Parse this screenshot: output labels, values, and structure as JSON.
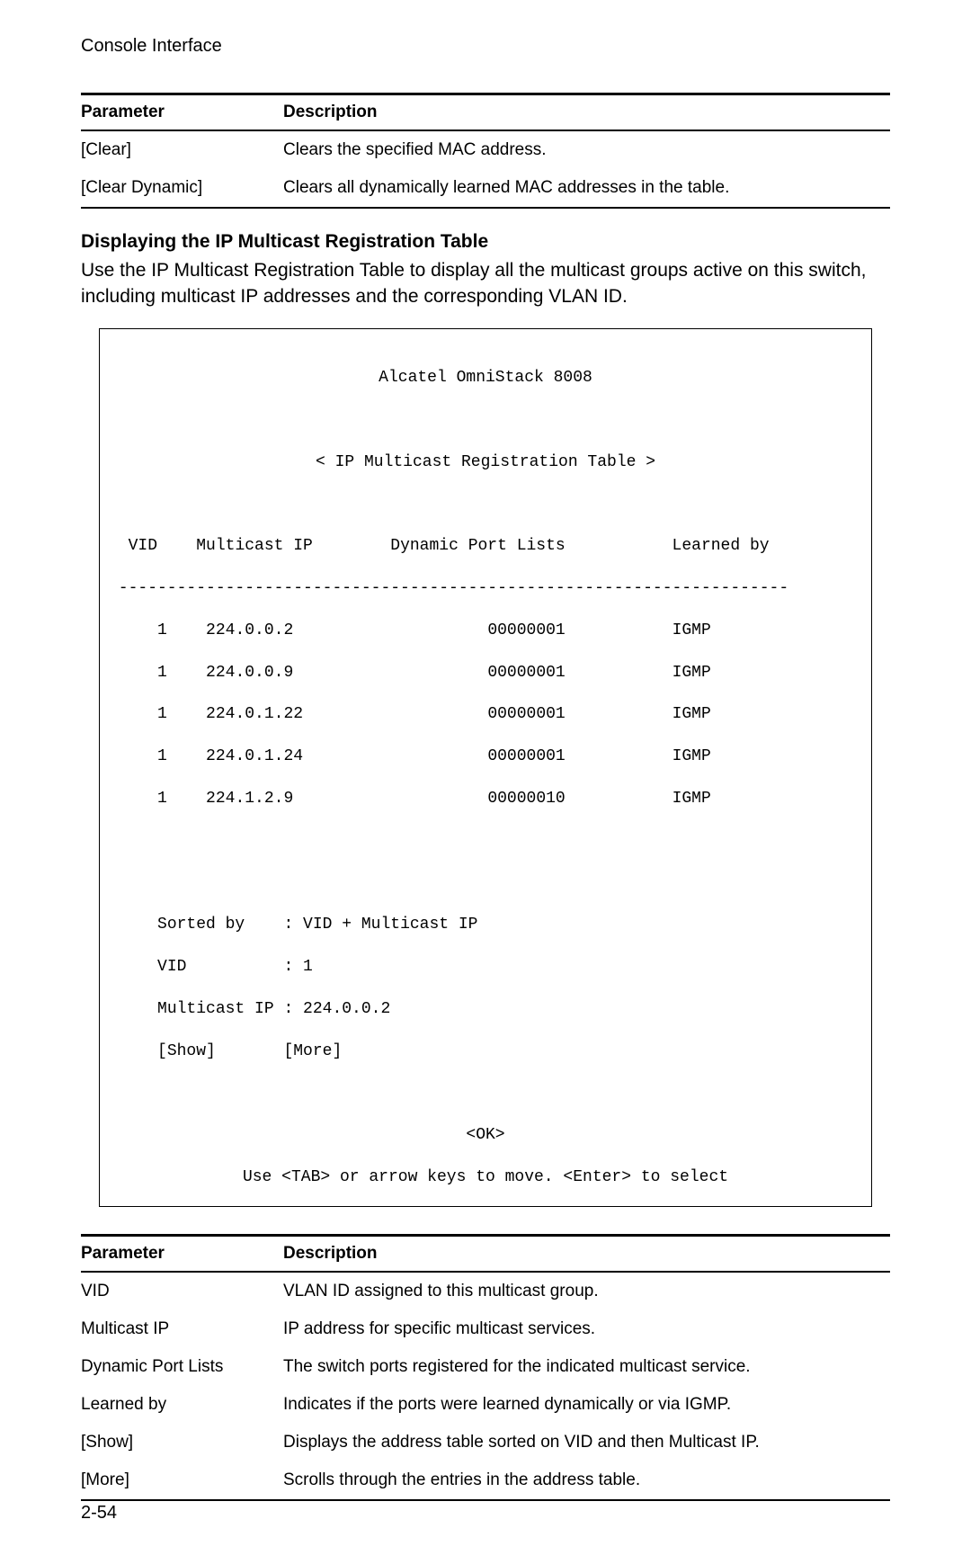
{
  "header": {
    "section_title": "Console Interface"
  },
  "table1": {
    "param_header": "Parameter",
    "desc_header": "Description",
    "rows": [
      {
        "param": "[Clear]",
        "desc": "Clears the specified MAC address."
      },
      {
        "param": "[Clear Dynamic]",
        "desc": "Clears all dynamically learned MAC addresses in the table."
      }
    ]
  },
  "subsection": {
    "heading": "Displaying the IP Multicast Registration Table",
    "body": "Use the IP Multicast Registration Table to display all the multicast groups active on this switch, including multicast IP addresses and the corresponding VLAN ID."
  },
  "console": {
    "device": "Alcatel OmniStack 8008",
    "screen_title": "< IP Multicast Registration Table >",
    "col_vid": "VID",
    "col_mip": "Multicast IP",
    "col_dpl": "Dynamic Port Lists",
    "col_lb": "Learned by",
    "rows": [
      {
        "vid": "1",
        "mip": "224.0.0.2",
        "dpl": "00000001",
        "lb": "IGMP"
      },
      {
        "vid": "1",
        "mip": "224.0.0.9",
        "dpl": "00000001",
        "lb": "IGMP"
      },
      {
        "vid": "1",
        "mip": "224.0.1.22",
        "dpl": "00000001",
        "lb": "IGMP"
      },
      {
        "vid": "1",
        "mip": "224.0.1.24",
        "dpl": "00000001",
        "lb": "IGMP"
      },
      {
        "vid": "1",
        "mip": "224.1.2.9",
        "dpl": "00000010",
        "lb": "IGMP"
      }
    ],
    "sorted_label": "Sorted by",
    "sorted_val": "VID + Multicast IP",
    "vid_label": "VID",
    "vid_val": "1",
    "mip_label": "Multicast IP",
    "mip_val": "224.0.0.2",
    "show": "[Show]",
    "more": "[More]",
    "ok": "<OK>",
    "hint": "Use <TAB> or arrow keys to move. <Enter> to select"
  },
  "table2": {
    "param_header": "Parameter",
    "desc_header": "Description",
    "rows": [
      {
        "param": "VID",
        "desc": "VLAN ID assigned to this multicast group."
      },
      {
        "param": "Multicast IP",
        "desc": "IP address for specific multicast services."
      },
      {
        "param": "Dynamic Port Lists",
        "desc": "The switch ports registered for the indicated multicast service."
      },
      {
        "param": "Learned by",
        "desc": "Indicates if the ports were learned dynamically or via IGMP."
      },
      {
        "param": "[Show]",
        "desc": "Displays the address table sorted on VID and then Multicast IP."
      },
      {
        "param": "[More]",
        "desc": "Scrolls through the entries in the address table."
      }
    ]
  },
  "page_number": "2-54"
}
